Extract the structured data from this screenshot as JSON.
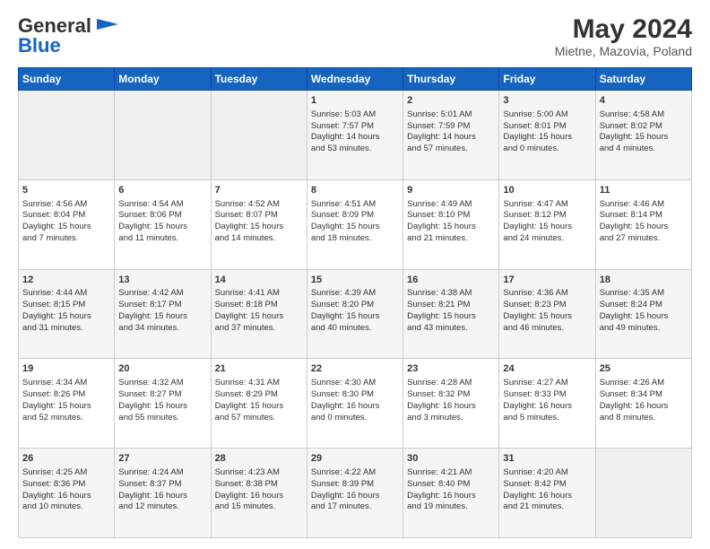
{
  "header": {
    "logo_line1": "General",
    "logo_line2": "Blue",
    "title": "May 2024",
    "subtitle": "Mietne, Mazovia, Poland"
  },
  "days_of_week": [
    "Sunday",
    "Monday",
    "Tuesday",
    "Wednesday",
    "Thursday",
    "Friday",
    "Saturday"
  ],
  "weeks": [
    [
      {
        "day": "",
        "info": ""
      },
      {
        "day": "",
        "info": ""
      },
      {
        "day": "",
        "info": ""
      },
      {
        "day": "1",
        "info": "Sunrise: 5:03 AM\nSunset: 7:57 PM\nDaylight: 14 hours\nand 53 minutes."
      },
      {
        "day": "2",
        "info": "Sunrise: 5:01 AM\nSunset: 7:59 PM\nDaylight: 14 hours\nand 57 minutes."
      },
      {
        "day": "3",
        "info": "Sunrise: 5:00 AM\nSunset: 8:01 PM\nDaylight: 15 hours\nand 0 minutes."
      },
      {
        "day": "4",
        "info": "Sunrise: 4:58 AM\nSunset: 8:02 PM\nDaylight: 15 hours\nand 4 minutes."
      }
    ],
    [
      {
        "day": "5",
        "info": "Sunrise: 4:56 AM\nSunset: 8:04 PM\nDaylight: 15 hours\nand 7 minutes."
      },
      {
        "day": "6",
        "info": "Sunrise: 4:54 AM\nSunset: 8:06 PM\nDaylight: 15 hours\nand 11 minutes."
      },
      {
        "day": "7",
        "info": "Sunrise: 4:52 AM\nSunset: 8:07 PM\nDaylight: 15 hours\nand 14 minutes."
      },
      {
        "day": "8",
        "info": "Sunrise: 4:51 AM\nSunset: 8:09 PM\nDaylight: 15 hours\nand 18 minutes."
      },
      {
        "day": "9",
        "info": "Sunrise: 4:49 AM\nSunset: 8:10 PM\nDaylight: 15 hours\nand 21 minutes."
      },
      {
        "day": "10",
        "info": "Sunrise: 4:47 AM\nSunset: 8:12 PM\nDaylight: 15 hours\nand 24 minutes."
      },
      {
        "day": "11",
        "info": "Sunrise: 4:46 AM\nSunset: 8:14 PM\nDaylight: 15 hours\nand 27 minutes."
      }
    ],
    [
      {
        "day": "12",
        "info": "Sunrise: 4:44 AM\nSunset: 8:15 PM\nDaylight: 15 hours\nand 31 minutes."
      },
      {
        "day": "13",
        "info": "Sunrise: 4:42 AM\nSunset: 8:17 PM\nDaylight: 15 hours\nand 34 minutes."
      },
      {
        "day": "14",
        "info": "Sunrise: 4:41 AM\nSunset: 8:18 PM\nDaylight: 15 hours\nand 37 minutes."
      },
      {
        "day": "15",
        "info": "Sunrise: 4:39 AM\nSunset: 8:20 PM\nDaylight: 15 hours\nand 40 minutes."
      },
      {
        "day": "16",
        "info": "Sunrise: 4:38 AM\nSunset: 8:21 PM\nDaylight: 15 hours\nand 43 minutes."
      },
      {
        "day": "17",
        "info": "Sunrise: 4:36 AM\nSunset: 8:23 PM\nDaylight: 15 hours\nand 46 minutes."
      },
      {
        "day": "18",
        "info": "Sunrise: 4:35 AM\nSunset: 8:24 PM\nDaylight: 15 hours\nand 49 minutes."
      }
    ],
    [
      {
        "day": "19",
        "info": "Sunrise: 4:34 AM\nSunset: 8:26 PM\nDaylight: 15 hours\nand 52 minutes."
      },
      {
        "day": "20",
        "info": "Sunrise: 4:32 AM\nSunset: 8:27 PM\nDaylight: 15 hours\nand 55 minutes."
      },
      {
        "day": "21",
        "info": "Sunrise: 4:31 AM\nSunset: 8:29 PM\nDaylight: 15 hours\nand 57 minutes."
      },
      {
        "day": "22",
        "info": "Sunrise: 4:30 AM\nSunset: 8:30 PM\nDaylight: 16 hours\nand 0 minutes."
      },
      {
        "day": "23",
        "info": "Sunrise: 4:28 AM\nSunset: 8:32 PM\nDaylight: 16 hours\nand 3 minutes."
      },
      {
        "day": "24",
        "info": "Sunrise: 4:27 AM\nSunset: 8:33 PM\nDaylight: 16 hours\nand 5 minutes."
      },
      {
        "day": "25",
        "info": "Sunrise: 4:26 AM\nSunset: 8:34 PM\nDaylight: 16 hours\nand 8 minutes."
      }
    ],
    [
      {
        "day": "26",
        "info": "Sunrise: 4:25 AM\nSunset: 8:36 PM\nDaylight: 16 hours\nand 10 minutes."
      },
      {
        "day": "27",
        "info": "Sunrise: 4:24 AM\nSunset: 8:37 PM\nDaylight: 16 hours\nand 12 minutes."
      },
      {
        "day": "28",
        "info": "Sunrise: 4:23 AM\nSunset: 8:38 PM\nDaylight: 16 hours\nand 15 minutes."
      },
      {
        "day": "29",
        "info": "Sunrise: 4:22 AM\nSunset: 8:39 PM\nDaylight: 16 hours\nand 17 minutes."
      },
      {
        "day": "30",
        "info": "Sunrise: 4:21 AM\nSunset: 8:40 PM\nDaylight: 16 hours\nand 19 minutes."
      },
      {
        "day": "31",
        "info": "Sunrise: 4:20 AM\nSunset: 8:42 PM\nDaylight: 16 hours\nand 21 minutes."
      },
      {
        "day": "",
        "info": ""
      }
    ]
  ]
}
